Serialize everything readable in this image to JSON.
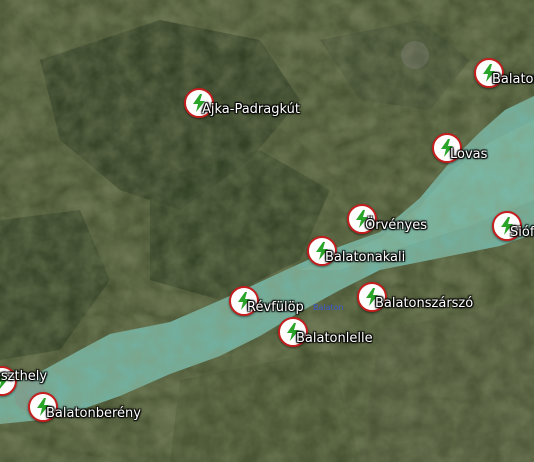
{
  "map": {
    "lake_label": "Balaton",
    "marker_icon": "lightning-bolt-icon",
    "marker_ring_color": "#c41e1e",
    "bolt_color": "#2aa52a",
    "markers": [
      {
        "id": "ajka",
        "label": "Ajka-Padragkút"
      },
      {
        "id": "balatonfured",
        "label": "Balaton"
      },
      {
        "id": "lovas",
        "label": "Lovas"
      },
      {
        "id": "orvenyes",
        "label": "Örvényes"
      },
      {
        "id": "siofok",
        "label": "Siófo"
      },
      {
        "id": "balatonakali",
        "label": "Balatonakali"
      },
      {
        "id": "revfulop",
        "label": "Révfülöp"
      },
      {
        "id": "balatonszarszo",
        "label": "Balatonszárszó"
      },
      {
        "id": "balatonlelle",
        "label": "Balatonlelle"
      },
      {
        "id": "keszthely",
        "label": "Keszthely"
      },
      {
        "id": "balatonbereny",
        "label": "Balatonberény"
      }
    ]
  }
}
